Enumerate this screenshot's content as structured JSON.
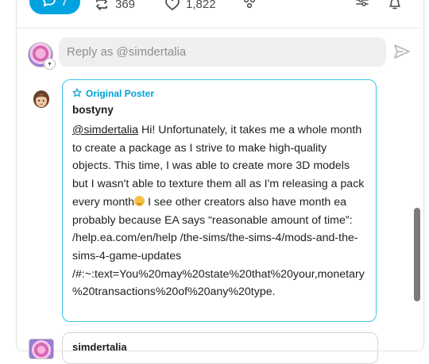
{
  "toolbar": {
    "reply_count": "7",
    "reblog_count": "369",
    "like_count": "1,822"
  },
  "reply_box": {
    "placeholder": "Reply as @simdertalia"
  },
  "comments": [
    {
      "badge": "Original Poster",
      "author": "bostyny",
      "mention": "@simdertalia",
      "text_before_emoji": " Hi! Unfortunately, it takes me a whole month to create a package as I strive to make high-quality objects. This time, I was able to create more 3D models but I wasn't able to texture them all as I'm releasing a pack every month",
      "text_after_emoji": " I see other creators also have month ea probably because EA says “reasonable amount of time”: /help.ea.com/en/help /the-sims/the-sims-4/mods-and-the-sims-4-game-updates /#:~:text=You%20may%20state%20that%20your,monetary%20transactions%20of%20any%20type."
    },
    {
      "author": "simdertalia"
    }
  ],
  "colors": {
    "accent": "#00a3e0",
    "op_border": "#3ec3ea"
  },
  "icons": [
    "reply-icon",
    "reblog-icon",
    "heart-icon",
    "share-icon",
    "settings-icon",
    "bell-icon",
    "send-icon",
    "star-icon"
  ]
}
